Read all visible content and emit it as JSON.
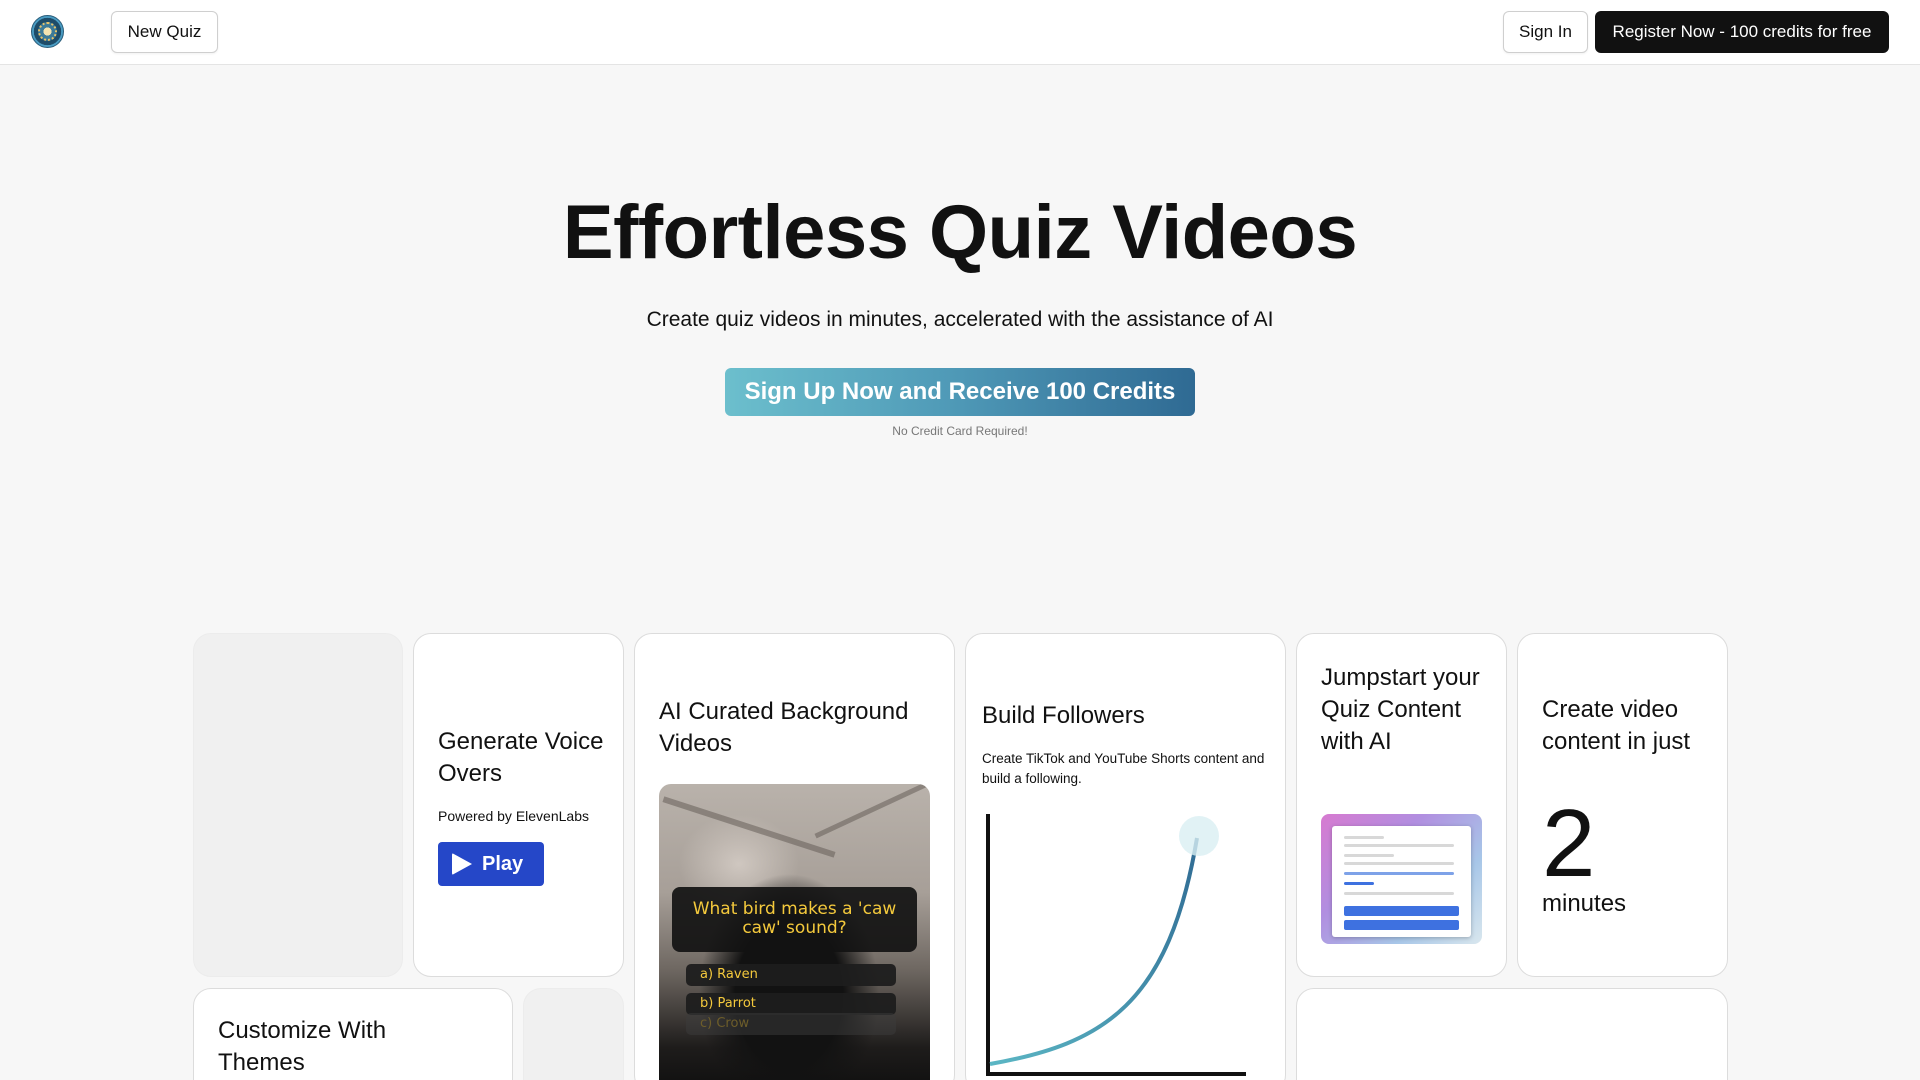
{
  "header": {
    "new_quiz_label": "New Quiz",
    "sign_in_label": "Sign In",
    "register_label": "Register Now - 100 credits for free"
  },
  "hero": {
    "title": "Effortless Quiz Videos",
    "subtitle": "Create quiz videos in minutes, accelerated with the assistance of AI",
    "cta_label": "Sign Up Now and Receive 100 Credits",
    "cta_note": "No Credit Card Required!"
  },
  "features": {
    "voice": {
      "title": "Generate Voice Overs",
      "powered_by": "Powered by ElevenLabs",
      "play_label": "Play"
    },
    "videos": {
      "title": "AI Curated Background Videos",
      "question": "What bird makes a 'caw caw' sound?",
      "options": [
        "a)  Raven",
        "b)  Parrot",
        "c)  Crow"
      ]
    },
    "followers": {
      "title": "Build Followers",
      "description": "Create TikTok and YouTube Shorts content and build a following."
    },
    "jumpstart": {
      "title": "Jumpstart your Quiz Content with AI"
    },
    "speed": {
      "title": "Create video content in just",
      "number": "2",
      "unit": "minutes"
    },
    "themes": {
      "title": "Customize With Themes"
    }
  },
  "colors": {
    "cta_gradient_start": "#6cbfcd",
    "cta_gradient_end": "#2f6a93",
    "play_button": "#2547c8",
    "quiz_text": "#f4c93c",
    "graph_curve": "#2f6a93"
  }
}
